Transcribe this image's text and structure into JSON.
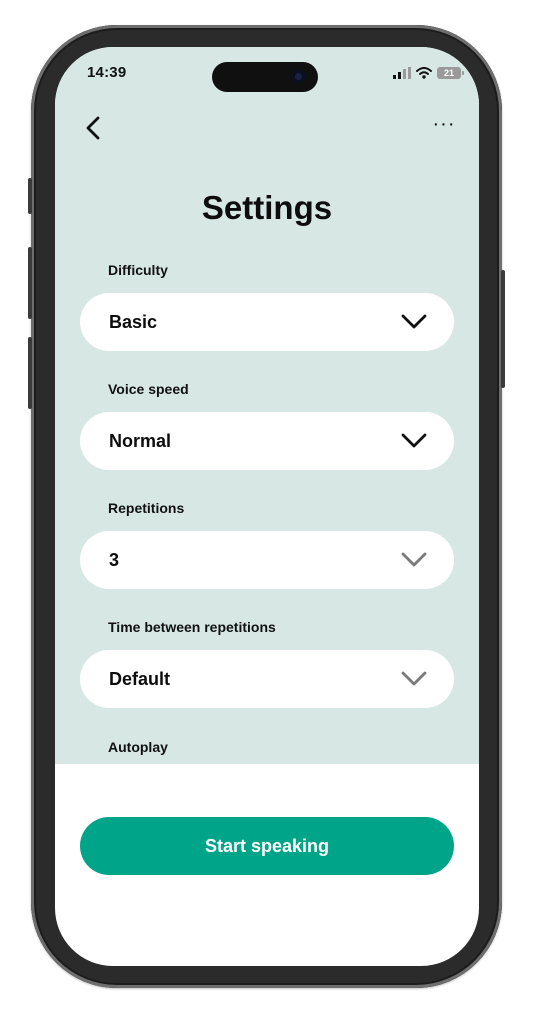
{
  "status_bar": {
    "time": "14:39",
    "battery": "21",
    "icons": [
      "signal-icon",
      "wifi-icon",
      "battery-icon"
    ]
  },
  "nav": {
    "back_icon": "chevron-left-icon",
    "more_label": "···"
  },
  "page": {
    "title": "Settings"
  },
  "settings": [
    {
      "label": "Difficulty",
      "value": "Basic",
      "chevron": "dark"
    },
    {
      "label": "Voice speed",
      "value": "Normal",
      "chevron": "dark"
    },
    {
      "label": "Repetitions",
      "value": "3",
      "chevron": "muted"
    },
    {
      "label": "Time between repetitions",
      "value": "Default",
      "chevron": "muted"
    },
    {
      "label": "Autoplay"
    }
  ],
  "footer": {
    "cta_label": "Start speaking"
  },
  "colors": {
    "background": "#d7e8e4",
    "accent": "#00a489",
    "chevron_dark": "#111111",
    "chevron_muted": "#7a7a7a"
  }
}
